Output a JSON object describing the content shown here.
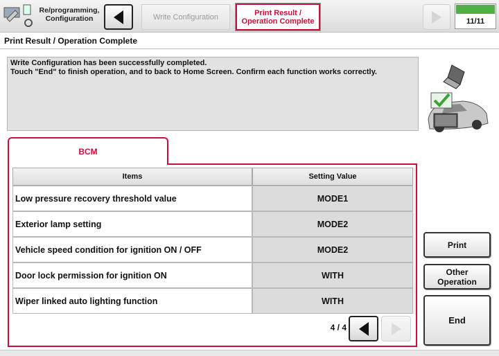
{
  "header": {
    "app_title": "Re/programming, Configuration",
    "steps": [
      {
        "label": "Write Configuration",
        "state": "inactive"
      },
      {
        "label": "Print Result / Operation Complete",
        "state": "active"
      }
    ],
    "progress": {
      "label": "11/11",
      "fraction": 1.0,
      "color": "#4fb043"
    }
  },
  "page_heading": "Print Result / Operation Complete",
  "message": {
    "line1": "Write Configuration has been successfully completed.",
    "line2": "Touch \"End\" to finish operation, and to back to Home Screen. Confirm each function works correctly."
  },
  "tab": {
    "label": "BCM"
  },
  "table": {
    "columns": [
      "Items",
      "Setting Value"
    ],
    "rows": [
      {
        "item": "Low pressure recovery threshold value",
        "value": "MODE1"
      },
      {
        "item": "Exterior lamp setting",
        "value": "MODE2"
      },
      {
        "item": "Vehicle speed condition for ignition ON / OFF",
        "value": "MODE2"
      },
      {
        "item": "Door lock permission for ignition ON",
        "value": "WITH"
      },
      {
        "item": "Wiper linked auto lighting function",
        "value": "WITH"
      }
    ]
  },
  "pager": {
    "label": "4 / 4"
  },
  "buttons": {
    "print": "Print",
    "other": "Other Operation",
    "end": "End"
  },
  "colors": {
    "accent": "#c8103c",
    "progress": "#4fb043"
  },
  "icons": [
    "app-icon",
    "back-arrow-icon",
    "forward-arrow-icon",
    "laptop-icon",
    "checkmark-icon",
    "car-icon"
  ]
}
